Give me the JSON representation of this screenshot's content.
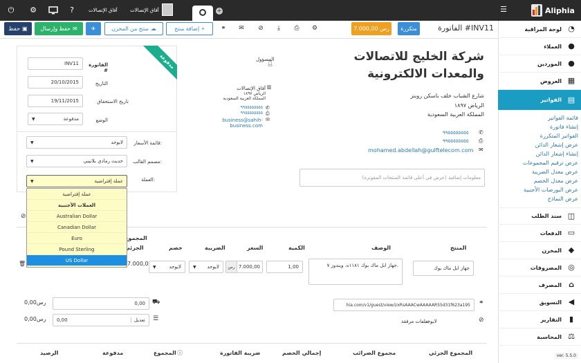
{
  "colors": {
    "topbar": "#2a2a2a",
    "accent": "#1a9cc3",
    "paid": "#1aae8c",
    "orange": "#f0a020",
    "recurring": "#3b8ed8",
    "green": "#2cb36b",
    "blue": "#3b8ed8",
    "navy": "#27416b"
  },
  "topbar": {
    "user_name": "آفاق الإتصالات",
    "company_link": "آفاق الإتصالات",
    "brand": "Aliphia"
  },
  "sidebar": {
    "items": [
      {
        "label": "لوحة المراقبة",
        "icon": "dashboard-icon"
      },
      {
        "label": "العملاء",
        "icon": "user-icon"
      },
      {
        "label": "الموردين",
        "icon": "users-icon"
      },
      {
        "label": "العروض",
        "icon": "calculator-icon"
      },
      {
        "label": "الفواتير",
        "icon": "file-icon"
      },
      {
        "label": "سند الطلب",
        "icon": "briefcase-icon"
      },
      {
        "label": "الدفعات",
        "icon": "credit-card-icon"
      },
      {
        "label": "المخزن",
        "icon": "cube-icon"
      },
      {
        "label": "المصروفات",
        "icon": "coins-icon"
      },
      {
        "label": "المصرف",
        "icon": "bank-icon"
      },
      {
        "label": "التسويق",
        "icon": "bullhorn-icon"
      },
      {
        "label": "التقارير",
        "icon": "bar-chart-icon"
      },
      {
        "label": "المحاسبة",
        "icon": "scale-icon"
      }
    ],
    "sub_items": [
      "قائمة الفواتير",
      "إنشاء فاتورة",
      "الفواتير المتكررة",
      "عرض إشعار الدائن",
      "إنشاء إشعار الدائن",
      "عرض ترقيم المجموعات",
      "عرض معدل الضريبة",
      "عرض معدل الخصم",
      "عرض البورصات الأجنبية",
      "عرض النماذج"
    ],
    "version": "ver. 5.5.0"
  },
  "toolbar": {
    "title": "الفاتورة #INV11",
    "recurring_badge": "متكررة",
    "amount_badge": "7.000,00 رس",
    "add_product": "إضافة منتج",
    "product_from_store": "منتج من المخزن",
    "save_send": "حفظ وإرسال",
    "save": "حفظ"
  },
  "company": {
    "name": "شركة الخليج للاتصالات والمعدات الالكترونية",
    "address1": "شارع الشباب خلف باسكن روبنز",
    "address2": "الرياض ١٨٩٧",
    "address3": "المملكة العربية السعودية",
    "phone1": "٩٩٥٥٥٥٥٥٥٥",
    "phone2": "٩٩٥٥٥٥٥٥٥٥",
    "email": "mohamed.abdellah@gulftelecom.com"
  },
  "responsible": {
    "label": "المسؤول"
  },
  "customer": {
    "name": "آفاق الإتصالات",
    "city": "الرياض ١٨٩٧",
    "country": "المملكة العربية السعودية",
    "phone1": "٩٩٥٥٥٥٥٥٥٥",
    "phone2": "٩٩٥٥٥٥٥٥٥٥",
    "email": "business@sahih-business.com"
  },
  "ribbon": "مدفوعة",
  "form": {
    "invoice_label": "الفاتورة #",
    "invoice_value": "INV11",
    "date_label": "التاريخ",
    "date_value": "20/10/2015",
    "due_label": "تاريخ الاستحقاق",
    "due_value": "19/11/2015",
    "status_label": "الوضع",
    "status_value": "مدفوعة",
    "pricelist_label": "قائمة الأسعار:",
    "pricelist_value": "لايوجد",
    "template_label": "مصمم القالب:",
    "template_value": "حديث رمادي بلاتيني",
    "currency_label": "العملة:",
    "currency_value": "عملة إفتراضية"
  },
  "currency_dropdown": {
    "options": [
      "عملة إفتراضية",
      "العملات الأجنبية",
      "Australian Dollar",
      "Canadian Dollar",
      "Euro",
      "Pound Sterling",
      "US Dollar"
    ],
    "selected": "US Dollar"
  },
  "notes_placeholder": "معلومات إضافية (عرض في أعلى قائمة المنتجات المفوترة)",
  "table": {
    "headers": {
      "product": "المنتج",
      "description": "الوصف",
      "qty": "الكمية",
      "price": "السعر",
      "tax": "الضريبة",
      "discount": "خصم",
      "subtotal": "الجزئي",
      "total": "المجموع"
    },
    "row": {
      "product": "جهاز ابل ماك بوك",
      "description": "جهاز ابل ماك بوك ١١٨١ه. ويندوز ٧.",
      "qty": "1,00",
      "price": "7.000,00",
      "currency": "رس",
      "tax": "لايوجد",
      "discount": "لايوجد",
      "subtotal": "7.000,00"
    }
  },
  "footer": {
    "link_value": "hia.com/v1/guest/view/i/xRsAAACwAAAAAR55d31f623a195",
    "attached_files_label": "ملفات مرفقة:",
    "attached_files_value": "لايوجد",
    "amount1": "0,00",
    "amount1_display": "0,00رس",
    "adjust_label": "تعديل",
    "amount2": "0,00",
    "amount2_display": "0,00رس"
  },
  "summary": {
    "subtotal": "المجموع الجزئي",
    "taxes": "مجموع الضرائب",
    "discount": "إجمالي الخصم",
    "invoice_tax": "ضريبة الفاتورة",
    "total": "المجموع",
    "paid": "مدفوعة",
    "balance": "الرصيد"
  }
}
